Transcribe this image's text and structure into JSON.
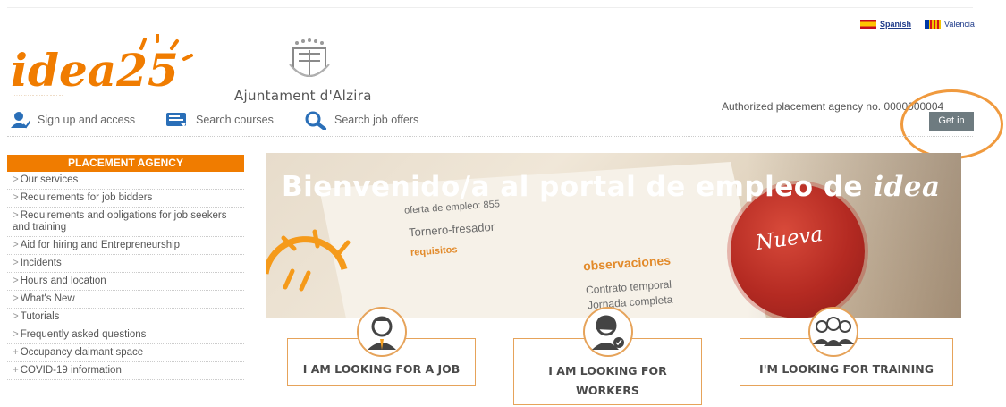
{
  "header": {
    "logo_text": "idea25",
    "city_name": "Ajuntament d'Alzira",
    "agency_label": "Authorized placement agency no. 0000000004",
    "get_in_label": "Get in"
  },
  "languages": [
    {
      "label": "Spanish"
    },
    {
      "label": "Valencia"
    }
  ],
  "quick_links": [
    {
      "label": "Sign up and access",
      "icon": "user-signup-icon"
    },
    {
      "label": "Search courses",
      "icon": "course-book-icon"
    },
    {
      "label": "Search job offers",
      "icon": "magnifier-icon"
    }
  ],
  "sidebar": {
    "title": "PLACEMENT AGENCY",
    "items": [
      {
        "prefix": ">",
        "label": "Our services"
      },
      {
        "prefix": ">",
        "label": "Requirements for job bidders"
      },
      {
        "prefix": ">",
        "label": "Requirements and obligations for job seekers and training"
      },
      {
        "prefix": ">",
        "label": "Aid for hiring and Entrepreneurship"
      },
      {
        "prefix": ">",
        "label": "Incidents"
      },
      {
        "prefix": ">",
        "label": "Hours and location"
      },
      {
        "prefix": ">",
        "label": "What's New"
      },
      {
        "prefix": ">",
        "label": "Tutorials"
      },
      {
        "prefix": ">",
        "label": "Frequently asked questions"
      },
      {
        "prefix": "+",
        "label": "Occupancy claimant space"
      },
      {
        "prefix": "+",
        "label": "COVID-19 information"
      }
    ]
  },
  "banner": {
    "title": "Bienvenido/a al portal de empleo de",
    "title_logo": "idea",
    "paper_lines": [
      "oferta de empleo: 855",
      "Tornero-fresador",
      "requisitos"
    ],
    "observations_title": "observaciones",
    "observations": [
      "Contrato temporal",
      "Jornada completa"
    ],
    "seal_text": "Nueva"
  },
  "actions": {
    "job": "I AM LOOKING FOR A JOB",
    "workers_line1": "I AM LOOKING FOR",
    "workers_line2": "WORKERS",
    "training": "I'M LOOKING FOR TRAINING"
  },
  "colors": {
    "accent": "#f07c00",
    "card_border": "#e6a35a",
    "button": "#6e7b80",
    "highlight": "#f09a3e"
  }
}
